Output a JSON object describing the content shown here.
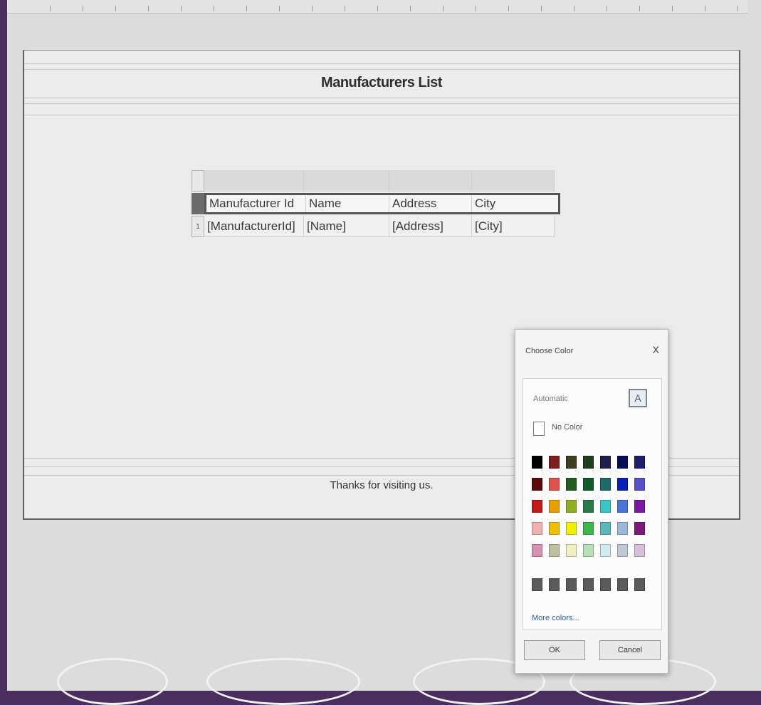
{
  "report": {
    "title": "Manufacturers List",
    "footer": "Thanks for visiting us."
  },
  "table": {
    "row_number": "1",
    "headers": [
      "Manufacturer Id",
      "Name",
      "Address",
      "City"
    ],
    "row": [
      "[ManufacturerId]",
      "[Name]",
      "[Address]",
      "[City]"
    ]
  },
  "color_dialog": {
    "title": "Choose Color",
    "close_glyph": "X",
    "automatic_label": "Automatic",
    "automatic_icon": "A",
    "no_color_label": "No Color",
    "more_colors": "More colors...",
    "ok": "OK",
    "cancel": "Cancel",
    "palette": [
      [
        "#000000",
        "#7f1d1d",
        "#3d3d1f",
        "#1f3d1f",
        "#1f1f4d",
        "#0b0b5e",
        "#1f1f6e"
      ],
      [
        "#5c0a0a",
        "#e0524a",
        "#1e5e1e",
        "#0f5a2a",
        "#1c6a6a",
        "#0a1eb8",
        "#5a50c8"
      ],
      [
        "#c41a1a",
        "#e8a000",
        "#8fae20",
        "#2a7a4a",
        "#39c6c6",
        "#4a74d8",
        "#7a1aa0"
      ],
      [
        "#f0b0b0",
        "#f0c000",
        "#f0f000",
        "#3ab84a",
        "#5ab8b8",
        "#9ab8d8",
        "#7a1a7a"
      ],
      [
        "#d890b0",
        "#c0c0a0",
        "#f0f0c0",
        "#b8e0b8",
        "#d0ecf0",
        "#c0c8d8",
        "#d8c0d8"
      ]
    ],
    "gray_palette": [
      "#5a5a5a",
      "#5a5a5a",
      "#5a5a5a",
      "#5a5a5a",
      "#5a5a5a",
      "#5a5a5a",
      "#5a5a5a"
    ]
  }
}
